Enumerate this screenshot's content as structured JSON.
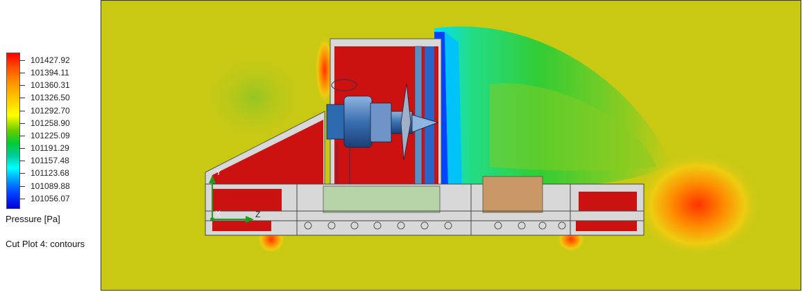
{
  "legend": {
    "values": [
      "101427.92",
      "101394.11",
      "101360.31",
      "101326.50",
      "101292.70",
      "101258.90",
      "101225.09",
      "101191.29",
      "101157.48",
      "101123.68",
      "101089.88",
      "101056.07"
    ],
    "title": "Pressure [Pa]",
    "plot_name": "Cut Plot 4: contours"
  },
  "axes": {
    "y": "Y",
    "x": "X",
    "z": "Z"
  },
  "colors": {
    "background_field": "#c9c914",
    "high_pressure": "#cc1111",
    "low_pressure": "#0044ff",
    "mid_pressure": "#33cc33",
    "structure_gray": "#d8d8d8",
    "triad_green": "#1aa01a"
  }
}
